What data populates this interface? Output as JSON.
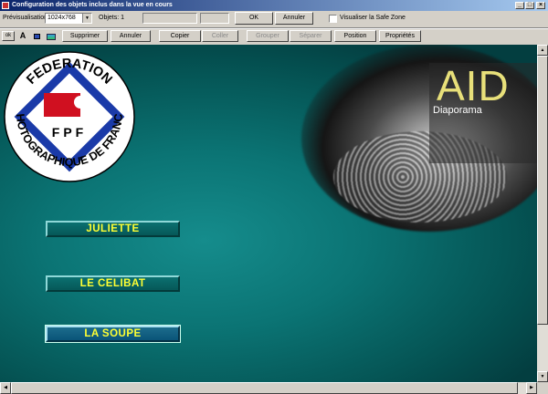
{
  "window": {
    "title": "Configuration des objets inclus dans la vue en cours",
    "controls": [
      "_",
      "□",
      "×"
    ]
  },
  "toolbar1": {
    "preview_label": "Prévisualisation",
    "preview_value": "1024x768",
    "objects_label": "Objets: 1",
    "ok_label": "OK",
    "cancel_label": "Annuler",
    "safezone_label": "Visualiser la Safe Zone"
  },
  "toolbar2": {
    "ok_small": "ok",
    "text_icon": "A",
    "delete_label": "Supprimer",
    "undo_label": "Annuler",
    "copy_label": "Copier",
    "paste_label": "Coller",
    "group_label": "Grouper",
    "ungroup_label": "Séparer",
    "position_label": "Position",
    "properties_label": "Propriétés"
  },
  "slide": {
    "logo": {
      "top_text": "FEDERATION",
      "bottom_text": "PHOTOGRAPHIQUE DE FRANCE",
      "initials": "FPF"
    },
    "brand": {
      "title": "AID",
      "subtitle": "Diaporama"
    },
    "buttons": [
      {
        "label": "JULIETTE"
      },
      {
        "label": "LE CELIBAT"
      },
      {
        "label": "LA SOUPE"
      }
    ]
  },
  "colors": {
    "titlebar_start": "#0a246a",
    "canvas_teal": "#0b7474",
    "button_text": "#ffff33",
    "logo_blue": "#1a3aa8",
    "logo_red": "#d01020"
  }
}
